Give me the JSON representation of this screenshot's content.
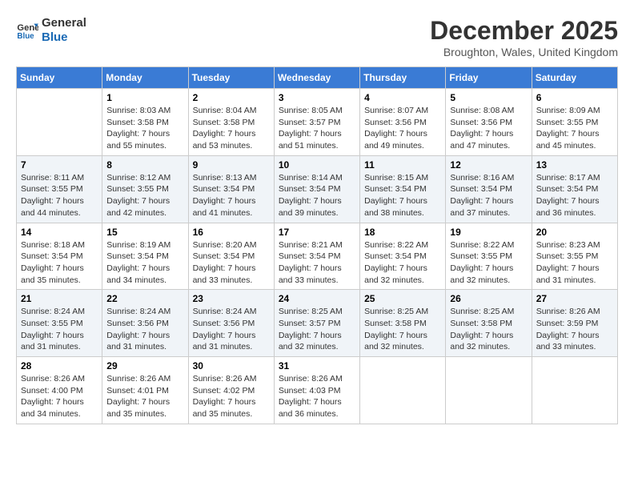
{
  "logo": {
    "line1": "General",
    "line2": "Blue"
  },
  "title": "December 2025",
  "subtitle": "Broughton, Wales, United Kingdom",
  "days_of_week": [
    "Sunday",
    "Monday",
    "Tuesday",
    "Wednesday",
    "Thursday",
    "Friday",
    "Saturday"
  ],
  "weeks": [
    [
      {
        "day": "",
        "info": ""
      },
      {
        "day": "1",
        "info": "Sunrise: 8:03 AM\nSunset: 3:58 PM\nDaylight: 7 hours\nand 55 minutes."
      },
      {
        "day": "2",
        "info": "Sunrise: 8:04 AM\nSunset: 3:58 PM\nDaylight: 7 hours\nand 53 minutes."
      },
      {
        "day": "3",
        "info": "Sunrise: 8:05 AM\nSunset: 3:57 PM\nDaylight: 7 hours\nand 51 minutes."
      },
      {
        "day": "4",
        "info": "Sunrise: 8:07 AM\nSunset: 3:56 PM\nDaylight: 7 hours\nand 49 minutes."
      },
      {
        "day": "5",
        "info": "Sunrise: 8:08 AM\nSunset: 3:56 PM\nDaylight: 7 hours\nand 47 minutes."
      },
      {
        "day": "6",
        "info": "Sunrise: 8:09 AM\nSunset: 3:55 PM\nDaylight: 7 hours\nand 45 minutes."
      }
    ],
    [
      {
        "day": "7",
        "info": "Sunrise: 8:11 AM\nSunset: 3:55 PM\nDaylight: 7 hours\nand 44 minutes."
      },
      {
        "day": "8",
        "info": "Sunrise: 8:12 AM\nSunset: 3:55 PM\nDaylight: 7 hours\nand 42 minutes."
      },
      {
        "day": "9",
        "info": "Sunrise: 8:13 AM\nSunset: 3:54 PM\nDaylight: 7 hours\nand 41 minutes."
      },
      {
        "day": "10",
        "info": "Sunrise: 8:14 AM\nSunset: 3:54 PM\nDaylight: 7 hours\nand 39 minutes."
      },
      {
        "day": "11",
        "info": "Sunrise: 8:15 AM\nSunset: 3:54 PM\nDaylight: 7 hours\nand 38 minutes."
      },
      {
        "day": "12",
        "info": "Sunrise: 8:16 AM\nSunset: 3:54 PM\nDaylight: 7 hours\nand 37 minutes."
      },
      {
        "day": "13",
        "info": "Sunrise: 8:17 AM\nSunset: 3:54 PM\nDaylight: 7 hours\nand 36 minutes."
      }
    ],
    [
      {
        "day": "14",
        "info": "Sunrise: 8:18 AM\nSunset: 3:54 PM\nDaylight: 7 hours\nand 35 minutes."
      },
      {
        "day": "15",
        "info": "Sunrise: 8:19 AM\nSunset: 3:54 PM\nDaylight: 7 hours\nand 34 minutes."
      },
      {
        "day": "16",
        "info": "Sunrise: 8:20 AM\nSunset: 3:54 PM\nDaylight: 7 hours\nand 33 minutes."
      },
      {
        "day": "17",
        "info": "Sunrise: 8:21 AM\nSunset: 3:54 PM\nDaylight: 7 hours\nand 33 minutes."
      },
      {
        "day": "18",
        "info": "Sunrise: 8:22 AM\nSunset: 3:54 PM\nDaylight: 7 hours\nand 32 minutes."
      },
      {
        "day": "19",
        "info": "Sunrise: 8:22 AM\nSunset: 3:55 PM\nDaylight: 7 hours\nand 32 minutes."
      },
      {
        "day": "20",
        "info": "Sunrise: 8:23 AM\nSunset: 3:55 PM\nDaylight: 7 hours\nand 31 minutes."
      }
    ],
    [
      {
        "day": "21",
        "info": "Sunrise: 8:24 AM\nSunset: 3:55 PM\nDaylight: 7 hours\nand 31 minutes."
      },
      {
        "day": "22",
        "info": "Sunrise: 8:24 AM\nSunset: 3:56 PM\nDaylight: 7 hours\nand 31 minutes."
      },
      {
        "day": "23",
        "info": "Sunrise: 8:24 AM\nSunset: 3:56 PM\nDaylight: 7 hours\nand 31 minutes."
      },
      {
        "day": "24",
        "info": "Sunrise: 8:25 AM\nSunset: 3:57 PM\nDaylight: 7 hours\nand 32 minutes."
      },
      {
        "day": "25",
        "info": "Sunrise: 8:25 AM\nSunset: 3:58 PM\nDaylight: 7 hours\nand 32 minutes."
      },
      {
        "day": "26",
        "info": "Sunrise: 8:25 AM\nSunset: 3:58 PM\nDaylight: 7 hours\nand 32 minutes."
      },
      {
        "day": "27",
        "info": "Sunrise: 8:26 AM\nSunset: 3:59 PM\nDaylight: 7 hours\nand 33 minutes."
      }
    ],
    [
      {
        "day": "28",
        "info": "Sunrise: 8:26 AM\nSunset: 4:00 PM\nDaylight: 7 hours\nand 34 minutes."
      },
      {
        "day": "29",
        "info": "Sunrise: 8:26 AM\nSunset: 4:01 PM\nDaylight: 7 hours\nand 35 minutes."
      },
      {
        "day": "30",
        "info": "Sunrise: 8:26 AM\nSunset: 4:02 PM\nDaylight: 7 hours\nand 35 minutes."
      },
      {
        "day": "31",
        "info": "Sunrise: 8:26 AM\nSunset: 4:03 PM\nDaylight: 7 hours\nand 36 minutes."
      },
      {
        "day": "",
        "info": ""
      },
      {
        "day": "",
        "info": ""
      },
      {
        "day": "",
        "info": ""
      }
    ]
  ]
}
